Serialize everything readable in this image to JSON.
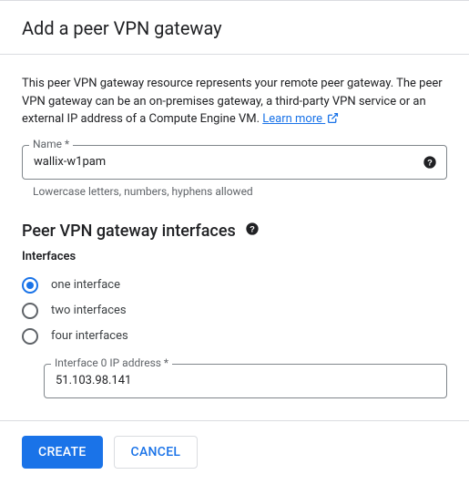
{
  "header": {
    "title": "Add a peer VPN gateway"
  },
  "body": {
    "description": "This peer VPN gateway resource represents your remote peer gateway. The peer VPN gateway can be an on-premises gateway, a third-party VPN service or an external IP address of a Compute Engine VM.",
    "learn_more": "Learn more",
    "name_field": {
      "label": "Name *",
      "value": "wallix-w1pam",
      "hint": "Lowercase letters, numbers, hyphens allowed"
    },
    "interfaces_section": {
      "title": "Peer VPN gateway interfaces",
      "group_label": "Interfaces",
      "options": [
        {
          "label": "one interface",
          "selected": true
        },
        {
          "label": "two interfaces",
          "selected": false
        },
        {
          "label": "four interfaces",
          "selected": false
        }
      ],
      "interface0": {
        "label": "Interface 0 IP address *",
        "value": "51.103.98.141"
      }
    }
  },
  "footer": {
    "create": "CREATE",
    "cancel": "CANCEL"
  }
}
